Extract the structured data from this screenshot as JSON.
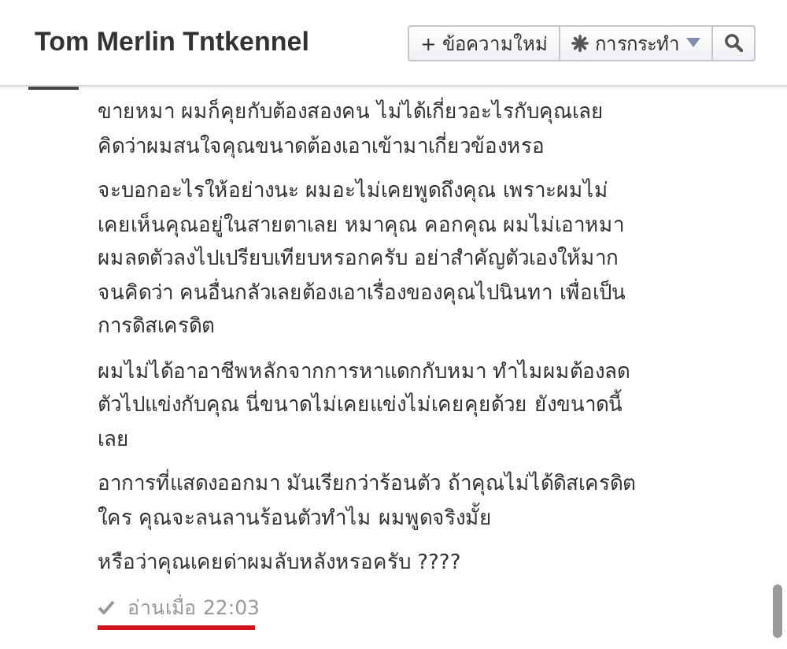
{
  "header": {
    "title": "Tom Merlin Tntkennel",
    "new_message_button": {
      "icon_text": "+",
      "label": "ข้อความใหม่"
    },
    "actions_button": {
      "label": "การกระทำ"
    }
  },
  "messages": [
    "ขายหมา ผมก็คุยกับต้องสองคน ไม่ได้เกี่ยวอะไรกับคุณเลย\nคิดว่าผมสนใจคุณขนาดต้องเอาเข้ามาเกี่ยวข้องหรอ",
    "จะบอกอะไรให้อย่างนะ ผมอะไม่เคยพูดถึงคุณ เพราะผมไม่\nเคยเห็นคุณอยู่ในสายตาเลย หมาคุณ คอกคุณ ผมไม่เอาหมา\nผมลดตัวลงไปเปรียบเทียบหรอกครับ อย่าสำคัญตัวเองให้มาก\nจนคิดว่า คนอื่นกลัวเลยต้องเอาเรื่องของคุณไปนินทา เพื่อเป็น\nการดิสเครดิต",
    "ผมไม่ได้อาอาชีพหลักจากการหาแดกกับหมา ทำไมผมต้องลด\nตัวไปแข่งกับคุณ นี่ขนาดไม่เคยแข่งไม่เคยคุยด้วย ยังขนาดนี้\nเลย",
    "อาการที่แสดงออกมา มันเรียกว่าร้อนตัว ถ้าคุณไม่ได้ดิสเครดิต\nใคร คุณจะลนลานร้อนตัวทำไม ผมพูดจริงมั้ย",
    "หรือว่าคุณเคยด่าผมลับหลังหรอครับ ????"
  ],
  "read_receipt": {
    "text": "อ่านเมื่อ 22:03",
    "seen": true,
    "underlined": true
  }
}
